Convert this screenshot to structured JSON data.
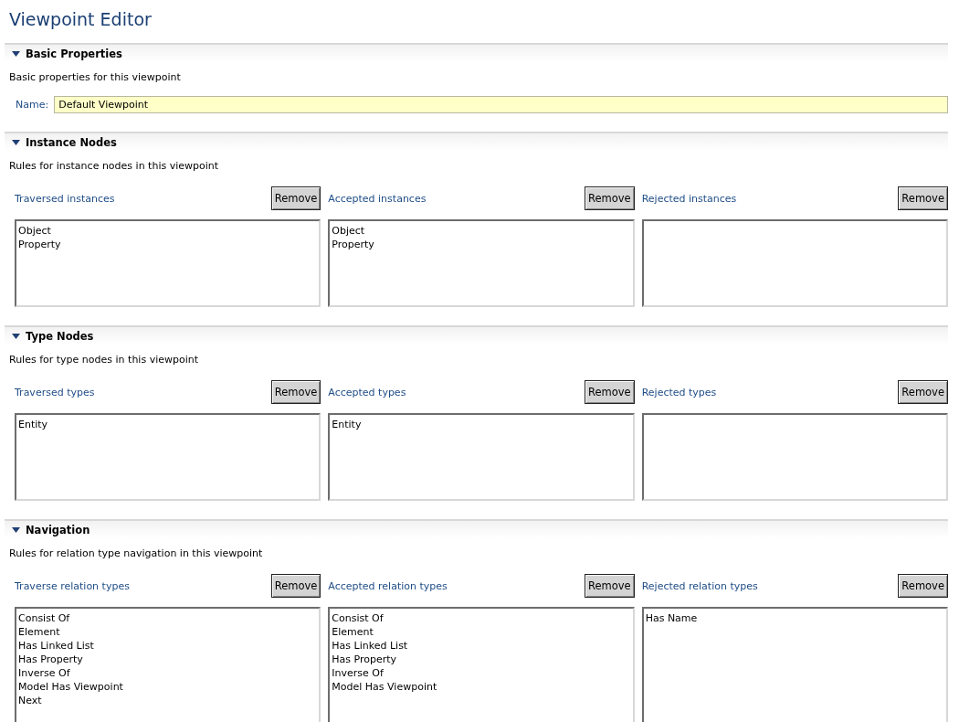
{
  "title": "Viewpoint Editor",
  "sections": [
    {
      "kind": "properties",
      "title": "Basic Properties",
      "expanded": true,
      "description": "Basic properties for this viewpoint",
      "field": {
        "label": "Name:",
        "value": "Default Viewpoint"
      }
    },
    {
      "kind": "lists",
      "title": "Instance Nodes",
      "expanded": true,
      "description": "Rules for instance nodes in this viewpoint",
      "columns": [
        {
          "label": "Traversed instances",
          "button": "Remove",
          "items": [
            "Object",
            "Property"
          ]
        },
        {
          "label": "Accepted instances",
          "button": "Remove",
          "items": [
            "Object",
            "Property"
          ]
        },
        {
          "label": "Rejected instances",
          "button": "Remove"
        }
      ]
    },
    {
      "kind": "lists",
      "title": "Type Nodes",
      "expanded": true,
      "description": "Rules for type nodes in this viewpoint",
      "columns": [
        {
          "label": "Traversed types",
          "button": "Remove",
          "items": [
            "Entity"
          ]
        },
        {
          "label": "Accepted types",
          "button": "Remove",
          "items": [
            "Entity"
          ]
        },
        {
          "label": "Rejected types",
          "button": "Remove"
        }
      ]
    },
    {
      "kind": "lists",
      "title": "Navigation",
      "expanded": true,
      "description": "Rules for relation type navigation in this viewpoint",
      "columns": [
        {
          "label": "Traverse relation types",
          "button": "Remove",
          "items": [
            "Consist Of",
            "Element",
            "Has Linked List",
            "Has Property",
            "Inverse Of",
            "Model Has Viewpoint",
            "Next"
          ]
        },
        {
          "label": "Accepted relation types",
          "button": "Remove",
          "items": [
            "Consist Of",
            "Element",
            "Has Linked List",
            "Has Property",
            "Inverse Of",
            "Model Has Viewpoint"
          ]
        },
        {
          "label": "Rejected relation types",
          "button": "Remove",
          "items": [
            "Has Name"
          ]
        }
      ]
    }
  ]
}
